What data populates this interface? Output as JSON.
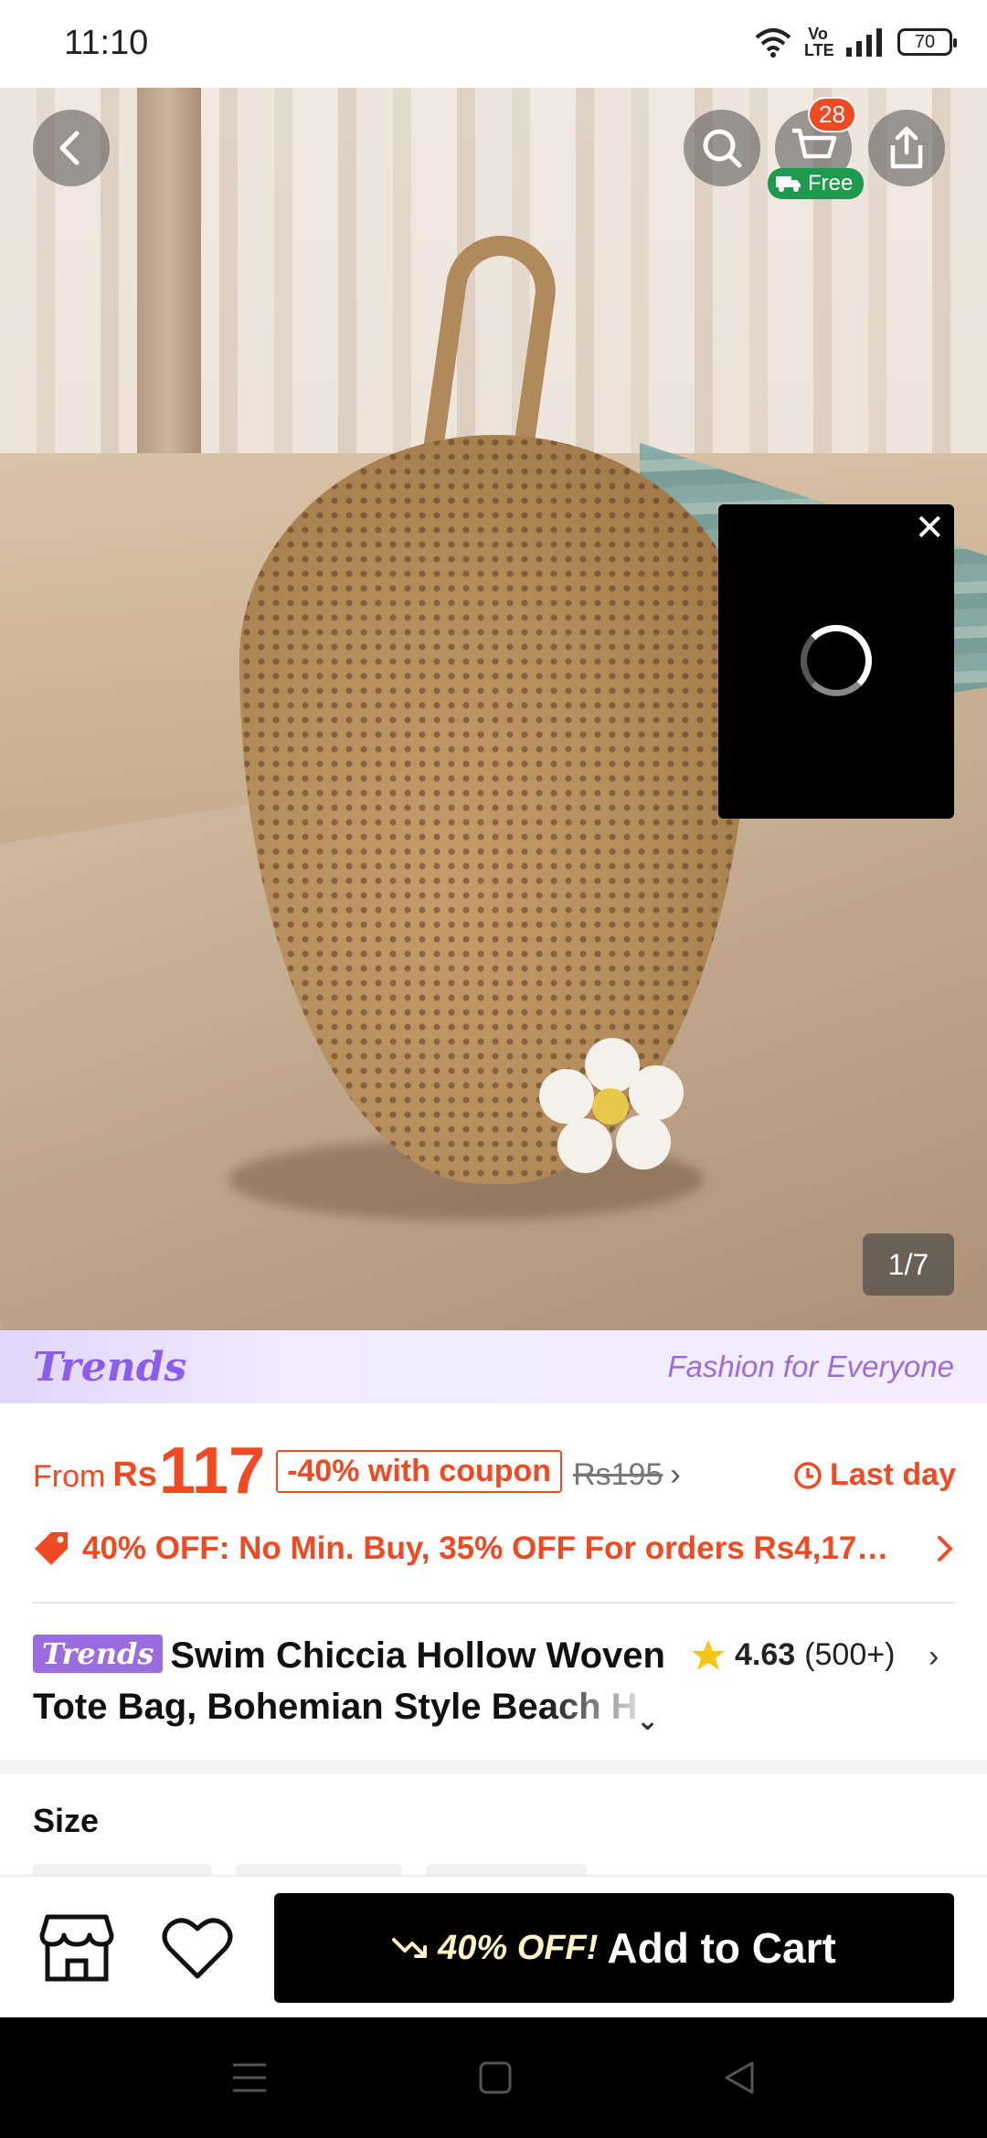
{
  "status": {
    "time": "11:10",
    "volte_label": "Vo LTE",
    "battery": "70"
  },
  "header": {
    "back_icon": "chevron-left-icon",
    "search_icon": "search-icon",
    "cart_icon": "cart-icon",
    "cart_count": "28",
    "free_shipping_label": "Free",
    "share_icon": "share-icon"
  },
  "gallery": {
    "page_indicator": "1/7",
    "video_close_label": "✕"
  },
  "banner": {
    "logo": "Trends",
    "tagline": "Fashion for Everyone"
  },
  "pricing": {
    "from_label": "From",
    "currency": "Rs",
    "price": "117",
    "coupon_label": "-40% with coupon",
    "original_price": "Rs195",
    "last_day_label": "Last day",
    "promo_text": "40% OFF: No Min. Buy,  35% OFF For orders Rs4,17…",
    "accent_color": "#f04a23"
  },
  "product": {
    "brand_badge": "Trends",
    "title_line1": "Swim Chiccia Hollow Woven",
    "title_line2": "Tote Bag, Bohemian Style Beach H",
    "rating": "4.63",
    "review_count": "(500+)"
  },
  "size_section": {
    "label": "Size"
  },
  "action_bar": {
    "store_icon": "store-icon",
    "wishlist_icon": "heart-icon",
    "cart_promo": "40% OFF!",
    "cart_label": "Add to Cart"
  },
  "nav": {
    "menu_icon": "menu-icon",
    "home_icon": "home-square-icon",
    "back_icon": "back-triangle-icon"
  }
}
